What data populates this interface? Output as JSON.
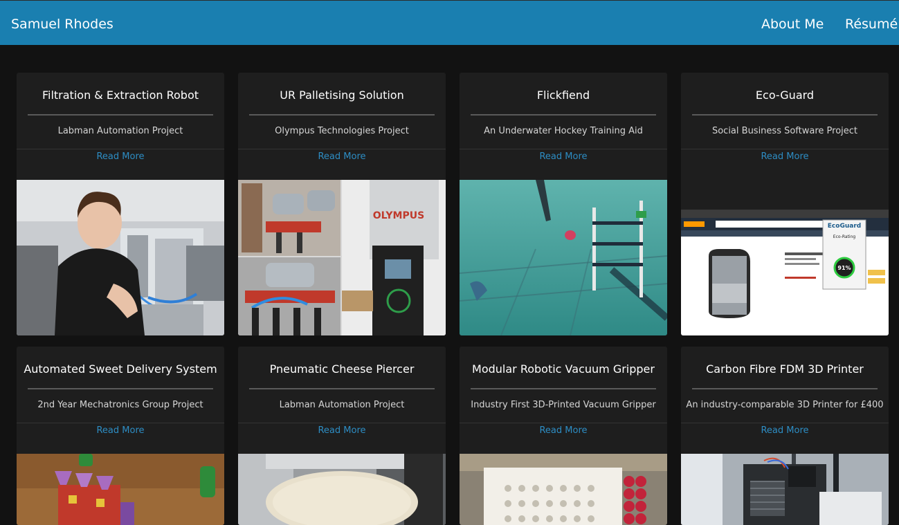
{
  "nav": {
    "brand": "Samuel Rhodes",
    "about": "About Me",
    "resume": "Résumé"
  },
  "cards": [
    {
      "title": "Filtration & Extraction Robot",
      "subtitle": "Labman Automation Project",
      "link": "Read More"
    },
    {
      "title": "UR Palletising Solution",
      "subtitle": "Olympus Technologies Project",
      "link": "Read More",
      "image_text": "OLYMPUS"
    },
    {
      "title": "Flickfiend",
      "subtitle": "An Underwater Hockey Training Aid",
      "link": "Read More"
    },
    {
      "title": "Eco-Guard",
      "subtitle": "Social Business Software Project",
      "link": "Read More",
      "image_text": {
        "brand": "EcoGuard",
        "rating": "Eco-Rating",
        "score": "91%"
      }
    },
    {
      "title": "Automated Sweet Delivery System",
      "subtitle": "2nd Year Mechatronics Group Project",
      "link": "Read More"
    },
    {
      "title": "Pneumatic Cheese Piercer",
      "subtitle": "Labman Automation Project",
      "link": "Read More"
    },
    {
      "title": "Modular Robotic Vacuum Gripper",
      "subtitle": "Industry First 3D-Printed Vacuum Gripper",
      "link": "Read More"
    },
    {
      "title": "Carbon Fibre FDM 3D Printer",
      "subtitle": "An industry-comparable 3D Printer for £400",
      "link": "Read More"
    }
  ],
  "colors": {
    "navbar": "#1a7fb0",
    "background": "#121212",
    "card": "#1e1e1e",
    "link": "#2d8dc4"
  }
}
